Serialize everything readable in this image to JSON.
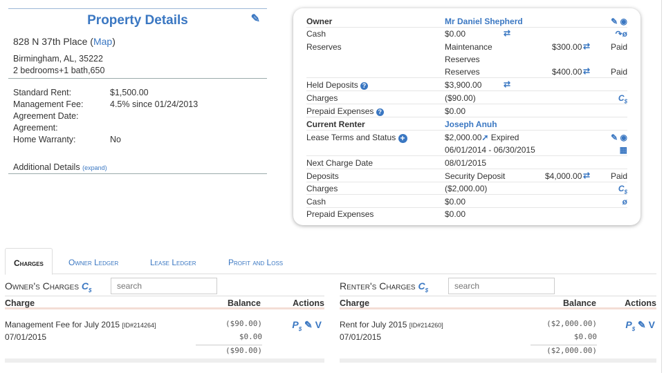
{
  "property": {
    "title": "Property Details",
    "address_street": "828 N 37th Place (",
    "map_link": "Map",
    "address_close": ")",
    "address_city": "Birmingham, AL, 35222",
    "address_rooms": "2 bedrooms+1 bath,650",
    "fields": [
      {
        "key": "Standard Rent:",
        "value": "$1,500.00"
      },
      {
        "key": "Management Fee:",
        "value": "4.5% since 01/24/2013"
      },
      {
        "key": "Agreement Date:",
        "value": ""
      },
      {
        "key": "Agreement:",
        "value": ""
      },
      {
        "key": "Home Warranty:",
        "value": "No"
      }
    ],
    "additional_label": "Additional Details",
    "expand_label": "(expand)"
  },
  "owner_card": {
    "owner_label": "Owner",
    "owner_name": "Mr Daniel Shepherd",
    "cash_label": "Cash",
    "cash_value": "$0.00",
    "reserves_label": "Reserves",
    "maintenance_label": "Maintenance",
    "maintenance_value": "$300.00",
    "maintenance_status": "Paid",
    "reserves_word": "Reserves",
    "reserves_sub_label": "Reserves",
    "reserves_value": "$400.00",
    "reserves_status": "Paid",
    "held_deposits_label": "Held Deposits",
    "held_deposits_value": "$3,900.00",
    "charges_label": "Charges",
    "charges_value": "($90.00)",
    "prepaid_label": "Prepaid Expenses",
    "prepaid_value": "$0.00",
    "current_renter_label": "Current Renter",
    "renter_name": "Joseph Anuh",
    "lease_terms_label": "Lease Terms and Status",
    "lease_amount": "$2,000.00",
    "lease_status": "Expired",
    "lease_dates": "06/01/2014 - 06/30/2015",
    "next_charge_label": "Next Charge Date",
    "next_charge_value": "08/01/2015",
    "deposits_label": "Deposits",
    "security_deposit_label": "Security Deposit",
    "security_deposit_value": "$4,000.00",
    "security_deposit_status": "Paid",
    "renter_charges_label": "Charges",
    "renter_charges_value": "($2,000.00)",
    "renter_cash_label": "Cash",
    "renter_cash_value": "$0.00",
    "renter_prepaid_label": "Prepaid Expenses",
    "renter_prepaid_value": "$0.00"
  },
  "tabs": [
    {
      "label": "Charges",
      "active": true
    },
    {
      "label": "Owner Ledger",
      "active": false
    },
    {
      "label": "Lease Ledger",
      "active": false
    },
    {
      "label": "Profit and Loss",
      "active": false
    }
  ],
  "owner_charges": {
    "title": "Owner's Charges",
    "search_placeholder": "search",
    "col_charge": "Charge",
    "col_balance": "Balance",
    "col_actions": "Actions",
    "row_name": "Management Fee for July 2015",
    "row_id": "[ID#214264]",
    "row_date": "07/01/2015",
    "row_balance": "($90.00)",
    "row_paid": "$0.00",
    "row_total": "($90.00)"
  },
  "renter_charges": {
    "title": "Renter's Charges",
    "search_placeholder": "search",
    "col_charge": "Charge",
    "col_balance": "Balance",
    "col_actions": "Actions",
    "row_name": "Rent for July 2015",
    "row_id": "[ID#214260]",
    "row_date": "07/01/2015",
    "row_balance": "($2,000.00)",
    "row_paid": "$0.00",
    "row_total": "($2,000.00)"
  },
  "icons": {
    "edit": "pencil-icon",
    "view": "eye-icon",
    "transfer": "transfer-arrows-icon",
    "calendar": "calendar-icon",
    "charge": "charge-c-dollar-icon",
    "pay": "pay-p-dollar-icon",
    "void": "void-v-icon"
  },
  "colors": {
    "accent": "#3a77c2"
  }
}
